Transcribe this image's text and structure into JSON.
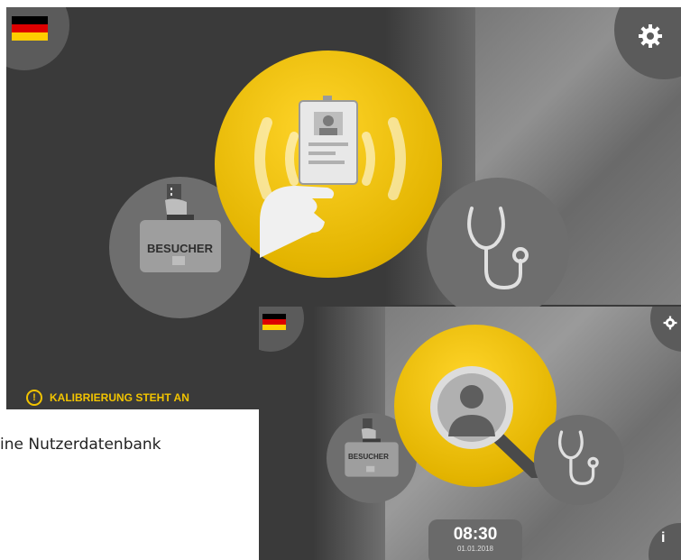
{
  "screen1": {
    "language_flag": "german-flag-icon",
    "settings_icon": "gear-icon",
    "visitor_button": {
      "label": "BESUCHER",
      "icon": "briefcase-icon"
    },
    "center_action_icon": "nfc-id-card-icon",
    "medical_button_icon": "stethoscope-icon",
    "warning_text": "KALIBRIERUNG STEHT AN"
  },
  "caption": "ine Nutzerdatenbank",
  "screen2": {
    "language_flag": "german-flag-icon",
    "settings_icon": "gear-icon",
    "visitor_button": {
      "label": "BESUCHER",
      "icon": "briefcase-icon"
    },
    "center_action_icon": "user-search-icon",
    "medical_button_icon": "stethoscope-icon",
    "clock": {
      "time": "08:30",
      "date": "01.01.2018"
    },
    "info_icon": "info-icon"
  },
  "colors": {
    "accent_yellow": "#f2c400",
    "panel_gray": "#3a3a3a",
    "button_gray": "#7a7a7a",
    "warning": "#f2c400"
  }
}
